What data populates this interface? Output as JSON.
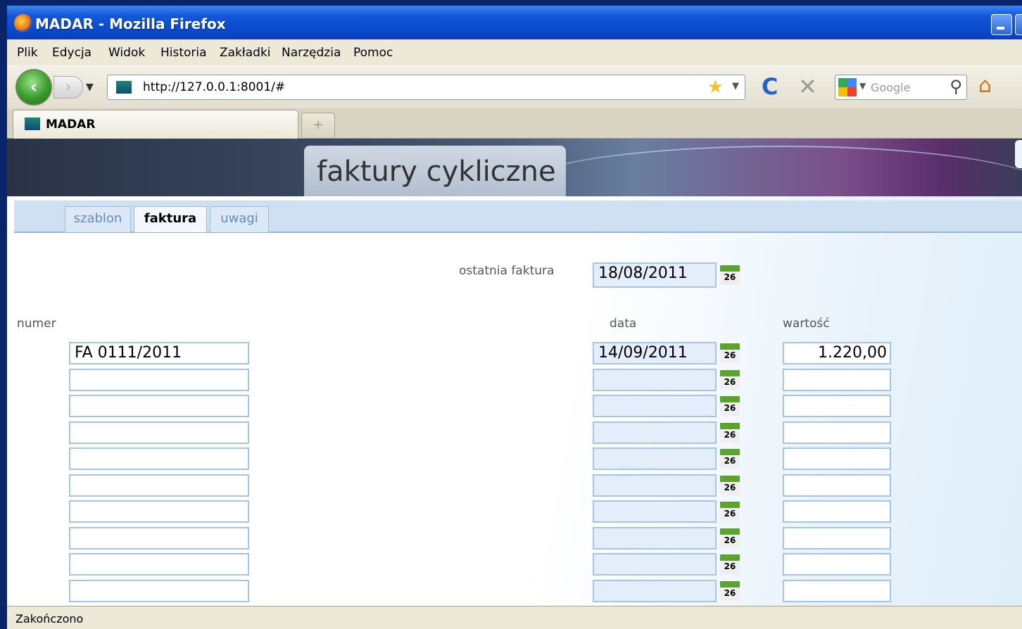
{
  "window": {
    "title": "MADAR - Mozilla Firefox"
  },
  "menu": [
    "Plik",
    "Edycja",
    "Widok",
    "Historia",
    "Zakładki",
    "Narzędzia",
    "Pomoc"
  ],
  "nav": {
    "url": "http://127.0.0.1:8001/#",
    "search_placeholder": "Google"
  },
  "browser_tab": {
    "title": "MADAR",
    "new_tab": "+"
  },
  "page": {
    "title": "faktury cykliczne",
    "tabs": [
      "szablon",
      "faktura",
      "uwagi"
    ],
    "active_tab": "faktura",
    "last_invoice_label": "ostatnia faktura",
    "last_invoice_value": "18/08/2011",
    "columns": {
      "number": "numer",
      "date": "data",
      "value": "wartość"
    },
    "calendar_day": "26",
    "rows": [
      {
        "number": "FA 0111/2011",
        "date": "14/09/2011",
        "value": "1.220,00"
      },
      {
        "number": "",
        "date": "",
        "value": ""
      },
      {
        "number": "",
        "date": "",
        "value": ""
      },
      {
        "number": "",
        "date": "",
        "value": ""
      },
      {
        "number": "",
        "date": "",
        "value": ""
      },
      {
        "number": "",
        "date": "",
        "value": ""
      },
      {
        "number": "",
        "date": "",
        "value": ""
      },
      {
        "number": "",
        "date": "",
        "value": ""
      },
      {
        "number": "",
        "date": "",
        "value": ""
      },
      {
        "number": "",
        "date": "",
        "value": ""
      }
    ]
  },
  "status": "Zakończono",
  "colors": {
    "accent": "#0a4ad0",
    "tab_bg": "#cfe0f3",
    "field_border": "#a6c5e3",
    "calendar_green": "#5aa32c"
  }
}
